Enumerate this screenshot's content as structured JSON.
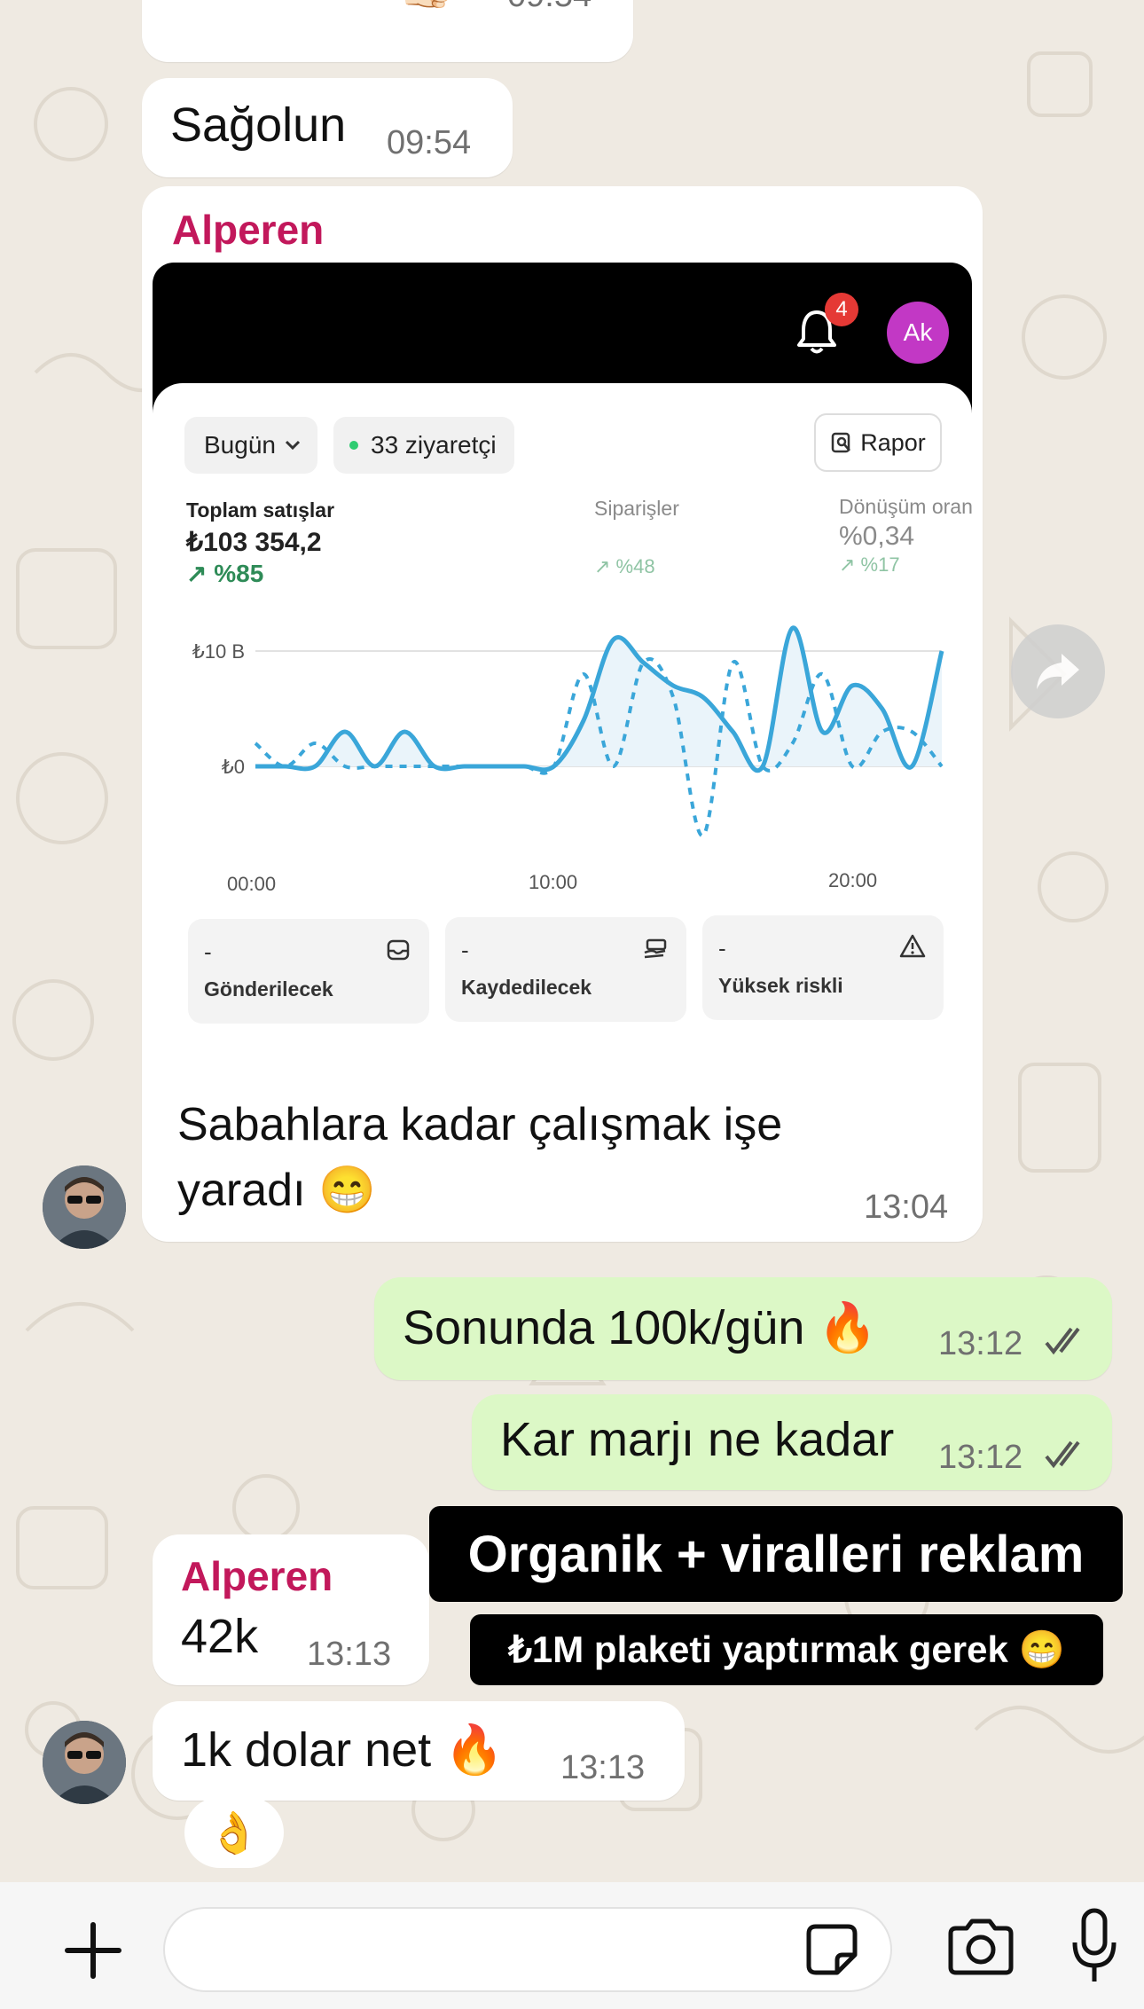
{
  "colors": {
    "chat_background": "#efeae2",
    "incoming_bubble": "#ffffff",
    "outgoing_bubble": "#dcf8c6",
    "sender_name": "#c2185b",
    "chart_line": "#3aa6d9",
    "notification_badge": "#e53935",
    "profile_avatar": "#c238c5",
    "positive_delta": "#2e8b57"
  },
  "messages": [
    {
      "text": "Tamamdır 👍🏻",
      "time": "09:54"
    },
    {
      "text": "Sağolun",
      "time": "09:54"
    },
    {
      "sender": "Alperen",
      "caption_line1": "Sabahlara kadar çalışmak işe",
      "caption_line2": "yaradı 😁",
      "time": "13:04",
      "screenshot": {
        "notification_count": "4",
        "avatar_initials": "Ak",
        "date_filter": "Bugün",
        "visitors": "33 ziyaretçi",
        "report_button": "Rapor",
        "metrics": [
          {
            "label": "Toplam satışlar",
            "value": "₺103 354,2",
            "delta": "↗ %85"
          },
          {
            "label": "Siparişler",
            "value": "",
            "delta": "↗ %48"
          },
          {
            "label": "Dönüşüm oranı",
            "value": "%0,34",
            "delta": "↗ %17"
          }
        ],
        "cards": [
          {
            "value": "-",
            "label": "Gönderilecek",
            "icon": "inbox-icon"
          },
          {
            "value": "-",
            "label": "Kaydedilecek",
            "icon": "hand-cash-icon"
          },
          {
            "value": "-",
            "label": "Yüksek riskli",
            "icon": "warning-icon"
          }
        ]
      }
    },
    {
      "text": "Sonunda 100k/gün 🔥",
      "time": "13:12"
    },
    {
      "text": "Kar marjı ne kadar",
      "time": "13:12"
    },
    {
      "sender": "Alperen",
      "text": "42k",
      "time": "13:13"
    },
    {
      "text": "1k dolar net 🔥",
      "time": "13:13",
      "reaction": "👌"
    }
  ],
  "story_overlay": {
    "line1": "Organik + viralleri reklam",
    "line2": "₺1M plaketi yaptırmak gerek 😁"
  },
  "chart_data": {
    "type": "line",
    "x_tick_labels": [
      "00:00",
      "10:00",
      "20:00"
    ],
    "y_tick_labels": [
      "₺0",
      "₺10 B"
    ],
    "x": [
      0,
      1,
      2,
      3,
      4,
      5,
      6,
      7,
      8,
      9,
      10,
      11,
      12,
      13,
      14,
      15,
      16,
      17,
      18,
      19,
      20,
      21,
      22,
      23
    ],
    "ylim": [
      -6,
      14
    ],
    "series": [
      {
        "style": "solid",
        "values": [
          0,
          0,
          0,
          3,
          0,
          3,
          0,
          0,
          0,
          0,
          0,
          4,
          11,
          9,
          7,
          6,
          3,
          0,
          12,
          3,
          7,
          5,
          0,
          10
        ]
      },
      {
        "style": "dashed",
        "values": [
          2,
          0,
          2,
          0,
          0,
          0,
          0,
          0,
          0,
          0,
          0,
          8,
          0,
          9,
          6,
          -6,
          9,
          0,
          2,
          8,
          0,
          3,
          3,
          0
        ]
      }
    ],
    "grid": true,
    "legend": "none"
  }
}
